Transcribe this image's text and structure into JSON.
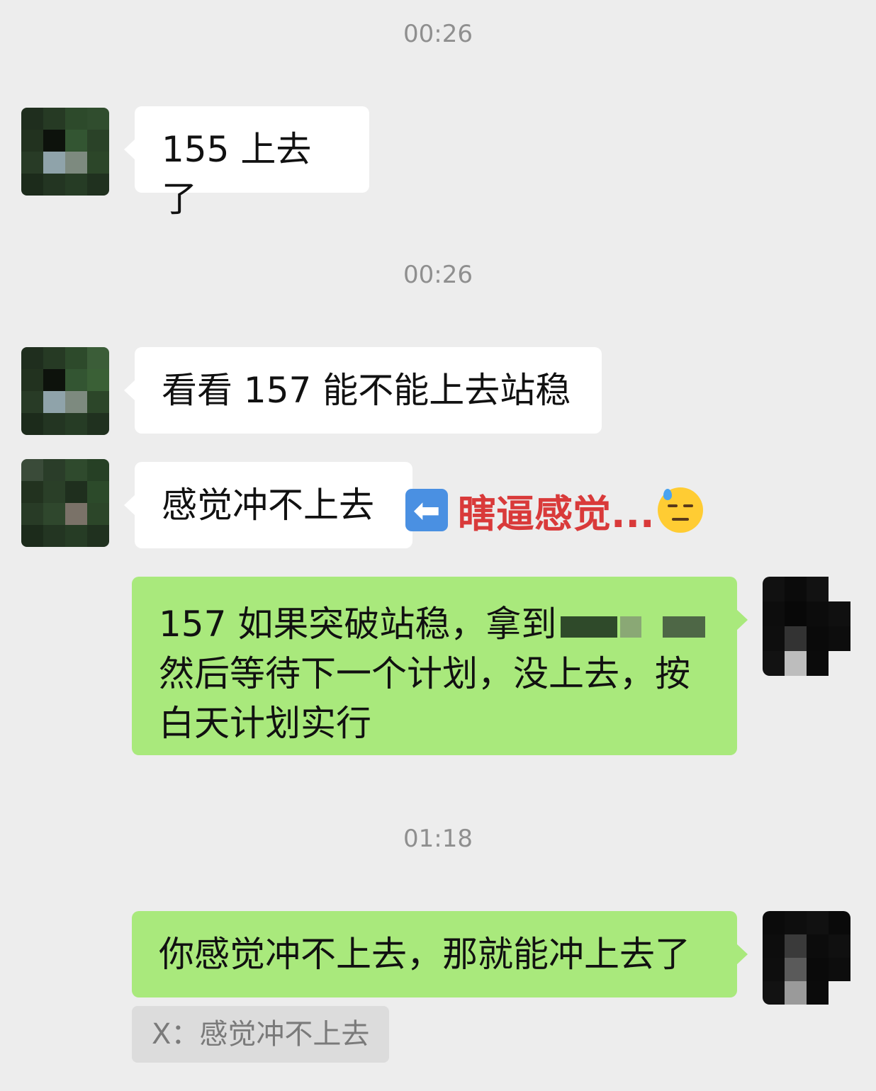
{
  "timestamps": [
    "00:26",
    "00:26",
    "01:18"
  ],
  "messages": [
    {
      "text": "155 上去了"
    },
    {
      "text": "看看 157 能不能上去站稳"
    },
    {
      "text": "感觉冲不上去"
    },
    {
      "text_line1": "157 如果突破站稳，拿到",
      "text_line2": "然后等待下一个计划，没上去，按",
      "text_line3": "白天计划实行"
    },
    {
      "text": "你感觉冲不上去，那就能冲上去了"
    }
  ],
  "annotation": {
    "text": "瞎逼感觉...",
    "arrow_icon": "left-arrow-icon",
    "face_icon": "downcast-sweat-face-icon",
    "color": "#d93a3a"
  },
  "quote": {
    "text": "X：感觉冲不上去"
  },
  "colors": {
    "background": "#ededed",
    "incoming_bubble": "#ffffff",
    "outgoing_bubble": "#a9e97c"
  }
}
